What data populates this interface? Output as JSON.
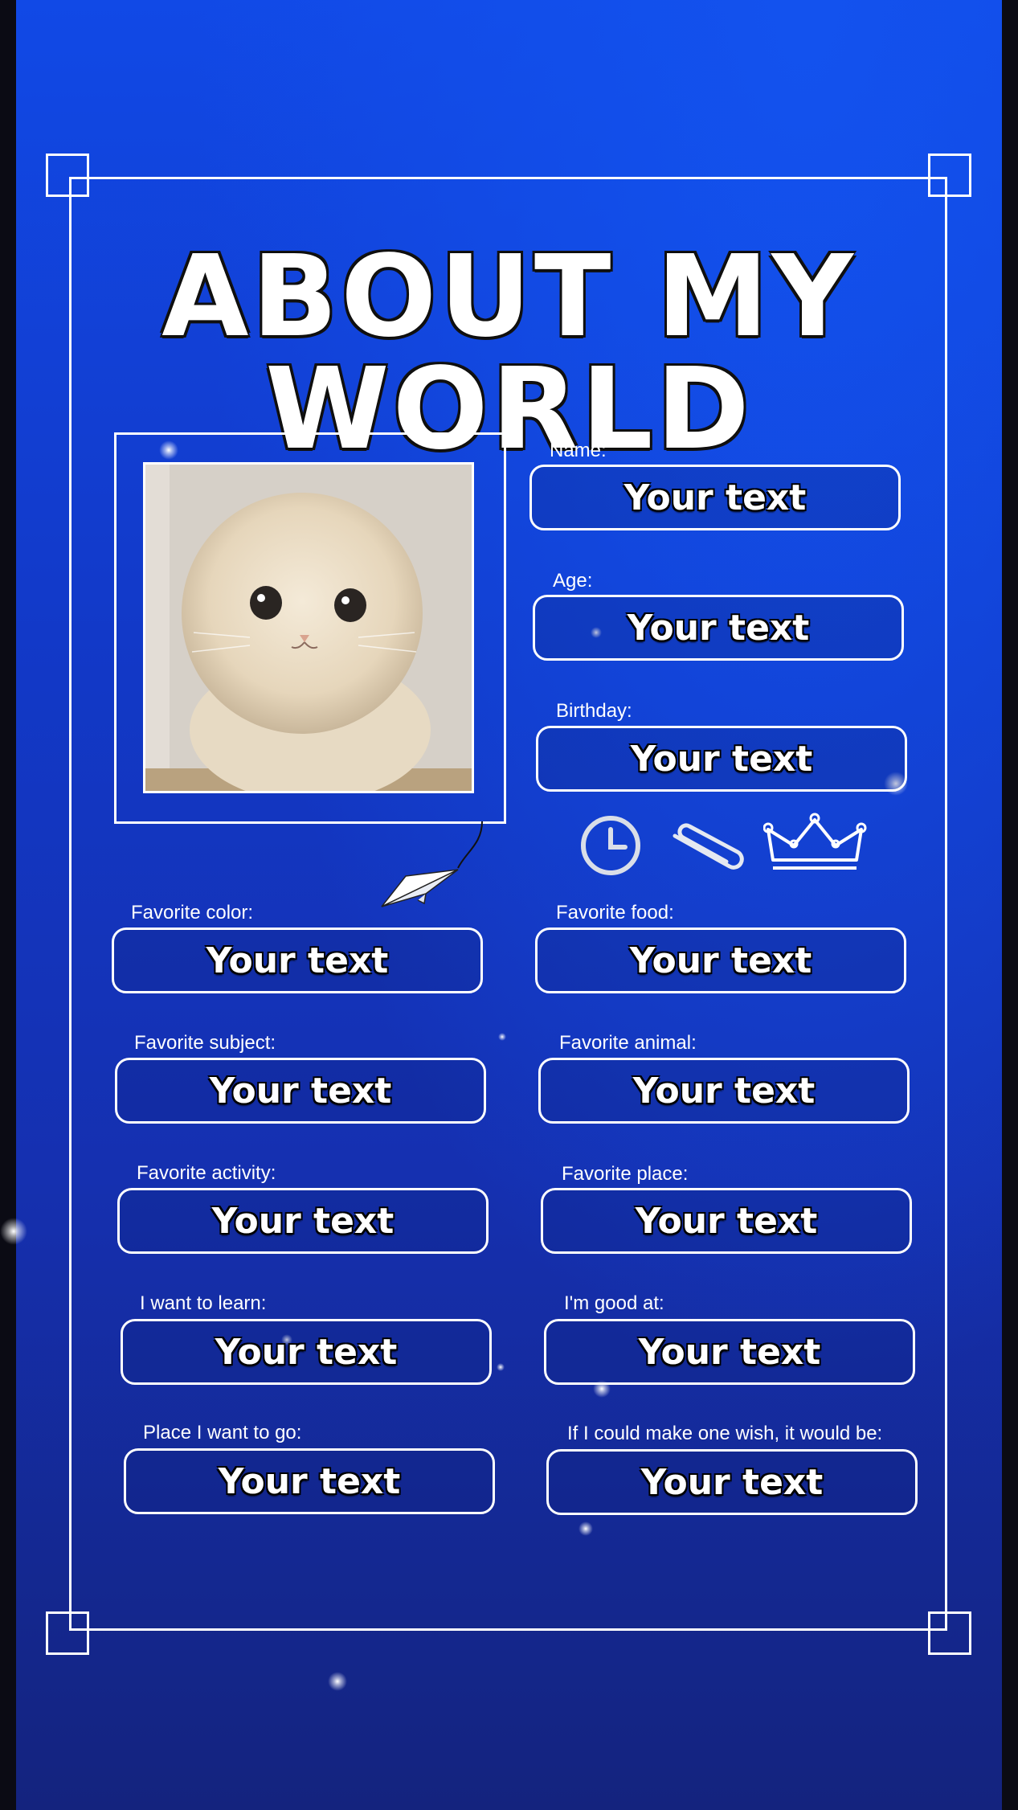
{
  "title": "ABOUT MY WORLD",
  "fields": {
    "name": {
      "label": "Name:",
      "value": "Your text"
    },
    "age": {
      "label": "Age:",
      "value": "Your text"
    },
    "birthday": {
      "label": "Birthday:",
      "value": "Your text"
    },
    "favorite_color": {
      "label": "Favorite color:",
      "value": "Your text"
    },
    "favorite_food": {
      "label": "Favorite food:",
      "value": "Your text"
    },
    "favorite_subject": {
      "label": "Favorite subject:",
      "value": "Your text"
    },
    "favorite_animal": {
      "label": "Favorite animal:",
      "value": "Your text"
    },
    "favorite_activity": {
      "label": "Favorite activity:",
      "value": "Your text"
    },
    "favorite_place": {
      "label": "Favorite place:",
      "value": "Your text"
    },
    "want_to_learn": {
      "label": "I want to learn:",
      "value": "Your text"
    },
    "good_at": {
      "label": "I'm good at:",
      "value": "Your text"
    },
    "place_to_go": {
      "label": "Place I want to go:",
      "value": "Your text"
    },
    "one_wish": {
      "label": "If I could make one wish, it would be:",
      "value": "Your text"
    }
  },
  "icons": [
    "clock-icon",
    "paperclip-icon",
    "crown-icon",
    "paper-plane-icon"
  ],
  "photo": "white-cat-photo",
  "colors": {
    "background_top": "#1149e6",
    "background_bottom": "#14237e",
    "line": "#ffffff",
    "side_bars": "#0b0b14"
  }
}
